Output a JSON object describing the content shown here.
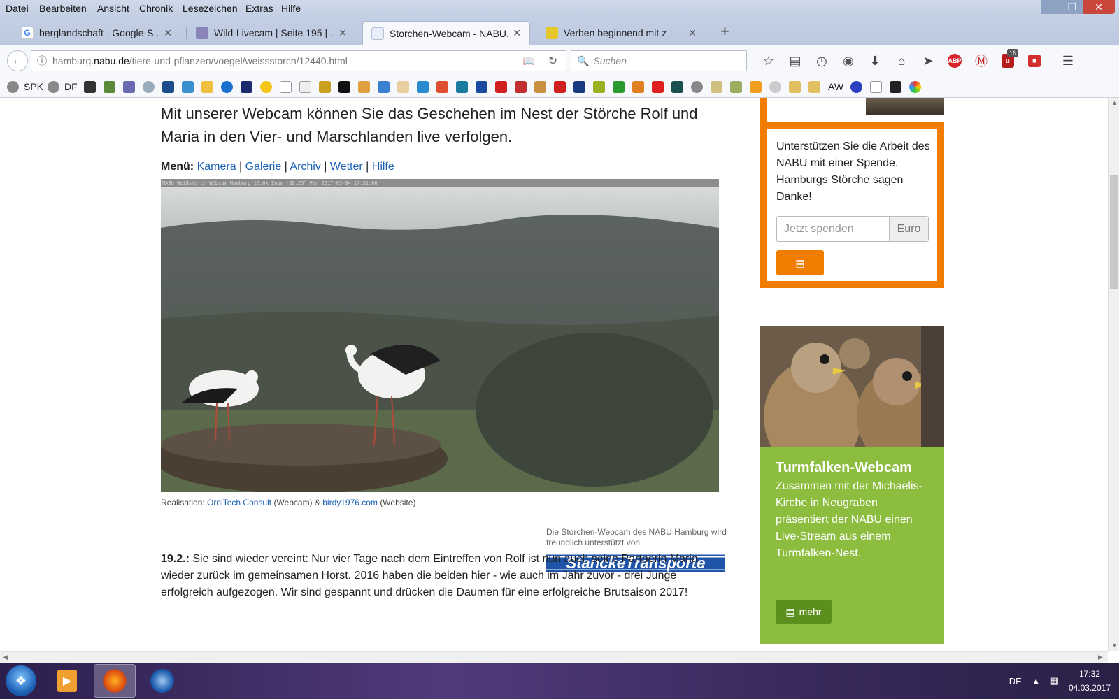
{
  "menubar": {
    "items": [
      "Datei",
      "Bearbeiten",
      "Ansicht",
      "Chronik",
      "Lesezeichen",
      "Extras",
      "Hilfe"
    ]
  },
  "tabs": [
    {
      "title": "berglandschaft - Google-S...",
      "icon": "google-icon",
      "color": "#ffffff"
    },
    {
      "title": "Wild-Livecam | Seite 195 | ...",
      "icon": "forum-icon",
      "color": "#8b84b8"
    },
    {
      "title": "Storchen-Webcam - NABU...",
      "icon": "nabu-icon",
      "color": "#e9eef6",
      "active": true
    },
    {
      "title": "Verben beginnend mit z",
      "icon": "cactus-icon",
      "color": "#e4c82a"
    }
  ],
  "navbar": {
    "url_prefix": "hamburg.",
    "url_domain": "nabu.de",
    "url_path": "/tiere-und-pflanzen/voegel/weissstorch/12440.html",
    "search_placeholder": "Suchen",
    "badge_count": "16"
  },
  "bookmarks": {
    "spk": "SPK",
    "df": "DF",
    "aw": "AW"
  },
  "page": {
    "lead": "Mit unserer Webcam können Sie das Geschehen im Nest der Störche Rolf und Maria in den Vier- und Marschlanden live verfolgen.",
    "menu_label": "Menü:",
    "menu_links": [
      "Kamera",
      "Galerie",
      "Archiv",
      "Wetter",
      "Hilfe"
    ],
    "webcam_caption": "NABU Weißstorch-Webcam Hamburg 10.0x Zoom -32.25° Pan 2017-03-04 17:31:06",
    "realisation_label": "Realisation:",
    "realisation_link1": "OrniTech Consult",
    "realisation_mid": "(Webcam) &",
    "realisation_link2": "birdy1976.com",
    "realisation_end": "(Website)",
    "sponsor_text": "Die Storchen-Webcam des NABU Hamburg wird freundlich unterstützt von",
    "sponsor_logo": "StanckeTransporte",
    "article_date": "19.2.:",
    "article_text": "Sie sind wieder vereint: Nur vier Tage nach dem Eintreffen von Rolf ist nun auch seine Partnerin Maria wieder zurück im gemeinsamen Horst. 2016 haben die beiden hier - wie auch im Jahr zuvor - drei Junge erfolgreich aufgezogen. Wir sind gespannt und drücken die Daumen für eine erfolgreiche Brutsaison 2017!"
  },
  "donate": {
    "text": "Unterstützen Sie die Arbeit des NABU mit einer Spende. Hamburgs Störche sagen Danke!",
    "placeholder": "Jetzt spenden",
    "currency": "Euro"
  },
  "falcon": {
    "title": "Turmfalken-Webcam",
    "text": "Zusammen mit der Michaelis-Kirche in Neugraben präsentiert der NABU einen Live-Stream aus einem Turmfalken-Nest.",
    "button": "mehr"
  },
  "taskbar": {
    "lang": "DE",
    "time": "17:32",
    "date": "04.03.2017"
  },
  "colors": {
    "nabu_orange": "#f07d00",
    "falcon_green": "#8cbd3f",
    "link_blue": "#1a5fb4"
  }
}
